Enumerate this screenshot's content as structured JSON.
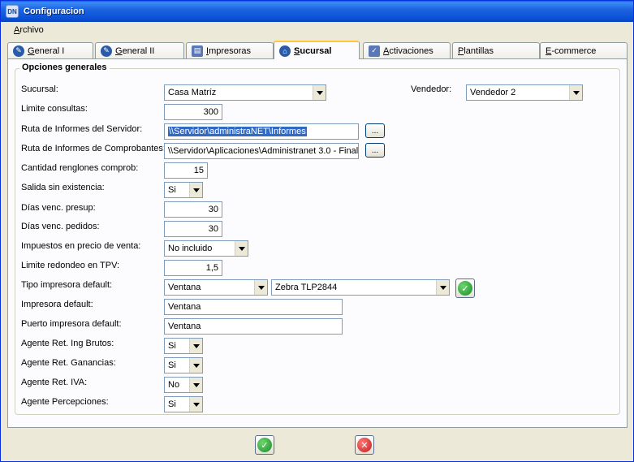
{
  "window": {
    "title": "Configuracion",
    "icon_text": "DN"
  },
  "menu": {
    "items": [
      "Archivo"
    ]
  },
  "tabs": [
    {
      "label": "General I",
      "icon": "wrench-icon"
    },
    {
      "label": "General II",
      "icon": "wrench-icon"
    },
    {
      "label": "Impresoras",
      "icon": "printer-icon"
    },
    {
      "label": "Sucursal",
      "icon": "building-icon",
      "active": true
    },
    {
      "label": "Activaciones",
      "icon": "checkbox-icon"
    },
    {
      "label": "Plantillas",
      "icon": ""
    },
    {
      "label": "E-commerce",
      "icon": ""
    }
  ],
  "group": {
    "title": "Opciones generales"
  },
  "form": {
    "sucursal": {
      "label": "Sucursal:",
      "value": "Casa Matríz"
    },
    "vendedor": {
      "label": "Vendedor:",
      "value": "Vendedor 2"
    },
    "limite_consultas": {
      "label": "Limite consultas:",
      "value": "300"
    },
    "ruta_servidor": {
      "label": "Ruta de Informes del Servidor:",
      "value": "\\\\Servidor\\administraNET\\Informes"
    },
    "ruta_comprobantes": {
      "label": "Ruta de Informes de Comprobantes:",
      "value": "\\\\Servidor\\Aplicaciones\\Administranet 3.0 - Final\\"
    },
    "cantidad_renglones": {
      "label": "Cantidad renglones comprob:",
      "value": "15"
    },
    "salida_sin_existencia": {
      "label": "Salida sin existencia:",
      "value": "Si"
    },
    "dias_presup": {
      "label": "Días venc. presup:",
      "value": "30"
    },
    "dias_pedidos": {
      "label": "Días venc. pedidos:",
      "value": "30"
    },
    "impuestos": {
      "label": "Impuestos en precio de venta:",
      "value": "No incluido"
    },
    "limite_redondeo": {
      "label": "Limite redondeo en TPV:",
      "value": "1,5"
    },
    "tipo_impresora": {
      "label": "Tipo impresora default:",
      "value": "Ventana",
      "printer": "Zebra  TLP2844"
    },
    "impresora_default": {
      "label": "Impresora default:",
      "value": "Ventana"
    },
    "puerto_impresora": {
      "label": "Puerto impresora default:",
      "value": "Ventana"
    },
    "agente_iibb": {
      "label": "Agente Ret. Ing Brutos:",
      "value": "Si"
    },
    "agente_ganancias": {
      "label": "Agente Ret. Ganancias:",
      "value": "Si"
    },
    "agente_iva": {
      "label": "Agente Ret. IVA:",
      "value": "No"
    },
    "agente_percepciones": {
      "label": "Agente Percepciones:",
      "value": "Si"
    }
  },
  "buttons": {
    "browse_label": "...",
    "ok_icon": "check-icon",
    "cancel_icon": "cancel-icon"
  }
}
